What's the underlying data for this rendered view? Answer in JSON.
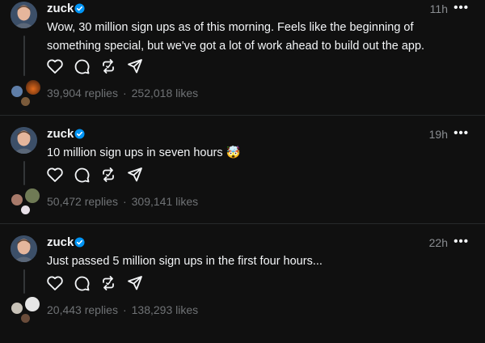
{
  "posts": [
    {
      "username": "zuck",
      "time": "11h",
      "text": "Wow, 30 million sign ups as of this morning. Feels like the beginning of something special, but we've got a lot of work ahead to build out the app.",
      "replies": "39,904 replies",
      "likes": "252,018 likes"
    },
    {
      "username": "zuck",
      "time": "19h",
      "text": "10 million sign ups in seven hours 🤯",
      "replies": "50,472 replies",
      "likes": "309,141 likes"
    },
    {
      "username": "zuck",
      "time": "22h",
      "text": "Just passed 5 million sign ups in the first four hours...",
      "replies": "20,443 replies",
      "likes": "138,293 likes"
    }
  ],
  "separator": "·",
  "more_glyph": "•••",
  "icons": [
    "heart-icon",
    "comment-icon",
    "repost-icon",
    "share-icon",
    "verified-badge-icon",
    "more-icon"
  ],
  "colors": {
    "background": "#101010",
    "text": "#f3f5f7",
    "muted": "#6f7275",
    "verified": "#0095f6"
  }
}
